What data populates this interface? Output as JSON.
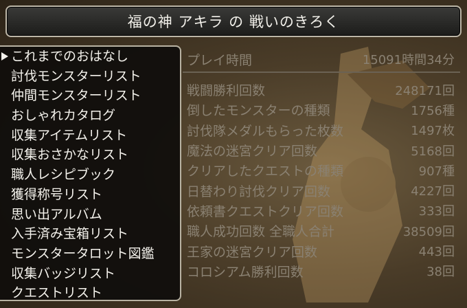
{
  "title": "福の神 アキラ の 戦いのきろく",
  "menu": [
    "これまでのおはなし",
    "討伐モンスターリスト",
    "仲間モンスターリスト",
    "おしゃれカタログ",
    "収集アイテムリスト",
    "収集おさかなリスト",
    "職人レシピブック",
    "獲得称号リスト",
    "思い出アルバム",
    "入手済み宝箱リスト",
    "モンスタータロット図鑑",
    "収集バッジリスト",
    "クエストリスト"
  ],
  "selected_menu_index": 0,
  "playtime": {
    "label": "プレイ時間",
    "value": "15091時間34分"
  },
  "stats": [
    {
      "label": "戦闘勝利回数",
      "value": "248171回"
    },
    {
      "label": "倒したモンスターの種類",
      "value": "1756種"
    },
    {
      "label": "討伐隊メダルもらった枚数",
      "value": "1497枚"
    },
    {
      "label": "魔法の迷宮クリア回数",
      "value": "5168回"
    },
    {
      "label": "クリアしたクエストの種類",
      "value": "907種"
    },
    {
      "label": "日替わり討伐クリア回数",
      "value": "4227回"
    },
    {
      "label": "依頼書クエストクリア回数",
      "value": "333回"
    },
    {
      "label": "職人成功回数 全職人合計",
      "value": "38509回"
    },
    {
      "label": "王家の迷宮クリア回数",
      "value": "443回"
    },
    {
      "label": "コロシアム勝利回数",
      "value": "38回"
    }
  ]
}
